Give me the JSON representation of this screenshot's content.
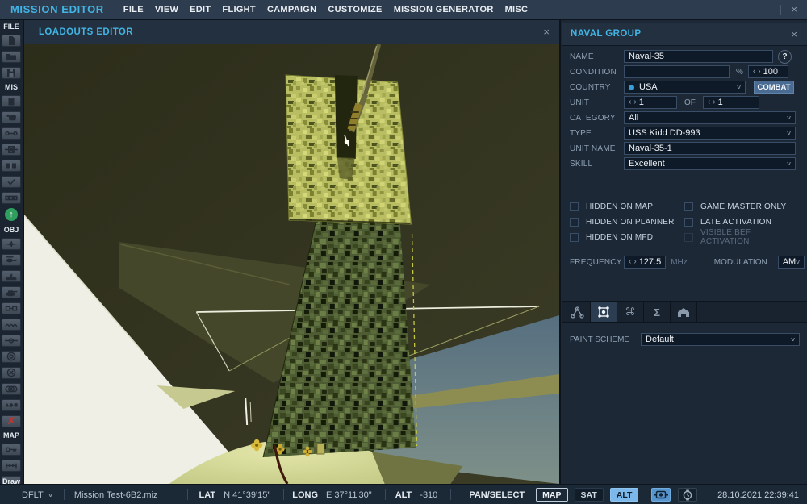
{
  "menu": {
    "title": "MISSION EDITOR",
    "items": [
      "FILE",
      "VIEW",
      "EDIT",
      "FLIGHT",
      "CAMPAIGN",
      "CUSTOMIZE",
      "MISSION GENERATOR",
      "MISC"
    ],
    "close": "×"
  },
  "sidebar": {
    "labels": {
      "file": "FILE",
      "mis": "MIS",
      "obj": "OBJ",
      "map": "MAP"
    },
    "draw_label": "Draw",
    "delete_glyph": "✗",
    "sync_glyph": "↑",
    "exit_glyph": "⏻"
  },
  "viewport": {
    "title": "LOADOUTS EDITOR",
    "close": "×"
  },
  "naval_group": {
    "title": "NAVAL GROUP",
    "close": "×",
    "help": "?",
    "name": {
      "label": "NAME",
      "value": "Naval-35"
    },
    "condition": {
      "label": "CONDITION",
      "value": "",
      "percent": "%",
      "spin_value": "100"
    },
    "country": {
      "label": "COUNTRY",
      "value": "USA",
      "combat": "COMBAT"
    },
    "unit": {
      "label": "UNIT",
      "count": "1",
      "of": "OF",
      "total": "1"
    },
    "category": {
      "label": "CATEGORY",
      "value": "All"
    },
    "type": {
      "label": "TYPE",
      "value": "USS Kidd DD-993"
    },
    "unit_name": {
      "label": "UNIT NAME",
      "value": "Naval-35-1"
    },
    "skill": {
      "label": "SKILL",
      "value": "Excellent"
    },
    "checkboxes_left": [
      "HIDDEN ON MAP",
      "HIDDEN ON PLANNER",
      "HIDDEN ON MFD"
    ],
    "checkboxes_right": [
      "GAME MASTER ONLY",
      "LATE ACTIVATION",
      "VISIBLE BEF. ACTIVATION"
    ],
    "frequency": {
      "label": "FREQUENCY",
      "value": "127.5",
      "unit": "MHz"
    },
    "modulation": {
      "label": "MODULATION",
      "value": "AM"
    },
    "paint_scheme": {
      "label": "PAINT SCHEME",
      "value": "Default"
    }
  },
  "glyphs": {
    "chevron_down": "∨",
    "spin_left": "‹",
    "spin_right": "›"
  },
  "statusbar": {
    "profile": "DFLT",
    "mission_file": "Mission Test-6B2.miz",
    "lat_label": "LAT",
    "lat_value": "N 41°39'15\"",
    "long_label": "LONG",
    "long_value": "E 37°11'30\"",
    "alt_label": "ALT",
    "alt_value": "-310",
    "mode": "PAN/SELECT",
    "map_btn": "MAP",
    "sat_btn": "SAT",
    "alt_btn": "ALT",
    "datetime": "28.10.2021 22:39:41"
  },
  "colors": {
    "accent": "#41b4e4",
    "panel_bg": "#1c2836",
    "combat_button": "#4b6c92",
    "alt_active": "#7cb9ea",
    "camo_light_base": "#b9be63",
    "camo_dark_base": "#4d5c32"
  }
}
